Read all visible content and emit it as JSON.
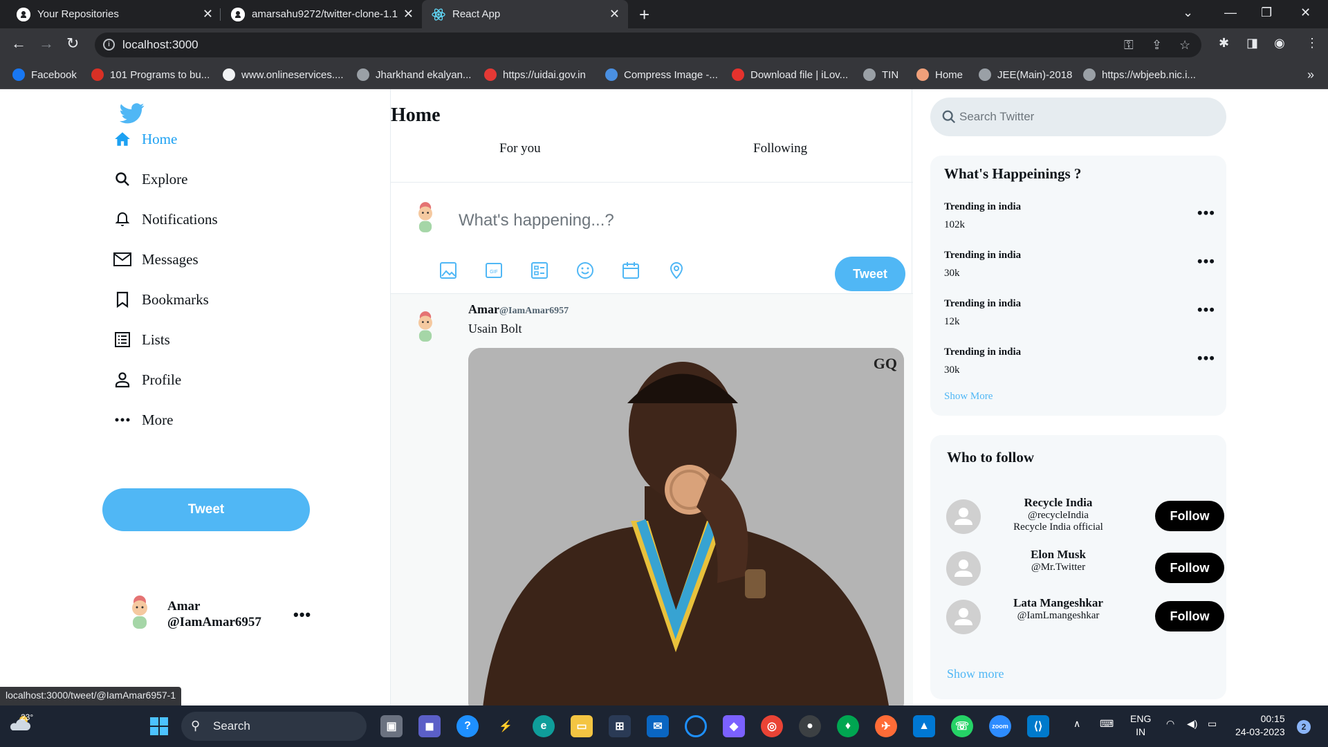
{
  "browser": {
    "tabs": [
      {
        "title": "Your Repositories"
      },
      {
        "title": "amarsahu9272/twitter-clone-1.1"
      },
      {
        "title": "React App"
      }
    ],
    "url": "localhost:3000",
    "bookmarks": [
      {
        "label": "Facebook",
        "color": "#1877f2"
      },
      {
        "label": "101 Programs to bu...",
        "color": "#d93025"
      },
      {
        "label": "www.onlineservices....",
        "color": "#f1f3f4"
      },
      {
        "label": "Jharkhand ekalyan...",
        "color": "#9aa0a6"
      },
      {
        "label": "https://uidai.gov.in",
        "color": "#e53935"
      },
      {
        "label": "Compress Image -...",
        "color": "#4a90e2"
      },
      {
        "label": "Download file | iLov...",
        "color": "#e5322d"
      },
      {
        "label": "TIN",
        "color": "#9aa0a6"
      },
      {
        "label": "Home",
        "color": "#f0a07a"
      },
      {
        "label": "JEE(Main)-2018",
        "color": "#9aa0a6"
      },
      {
        "label": "https://wbjeeb.nic.i...",
        "color": "#9aa0a6"
      }
    ],
    "status_url": "localhost:3000/tweet/@IamAmar6957-1"
  },
  "sidebar": {
    "nav": [
      {
        "label": "Home",
        "icon": "home-icon"
      },
      {
        "label": "Explore",
        "icon": "search-icon"
      },
      {
        "label": "Notifications",
        "icon": "bell-icon"
      },
      {
        "label": "Messages",
        "icon": "mail-icon"
      },
      {
        "label": "Bookmarks",
        "icon": "bookmark-icon"
      },
      {
        "label": "Lists",
        "icon": "list-icon"
      },
      {
        "label": "Profile",
        "icon": "person-icon"
      },
      {
        "label": "More",
        "icon": "more-icon"
      }
    ],
    "tweet_button": "Tweet",
    "user": {
      "name": "Amar",
      "handle": "@IamAmar6957"
    }
  },
  "feed": {
    "title": "Home",
    "tabs": [
      "For you",
      "Following"
    ],
    "compose_placeholder": "What's happening...?",
    "compose_icons": [
      "image-icon",
      "gif-icon",
      "poll-icon",
      "emoji-icon",
      "schedule-icon",
      "location-icon"
    ],
    "tweet_button": "Tweet",
    "post": {
      "name": "Amar",
      "handle": "@IamAmar6957",
      "text": "Usain Bolt",
      "image_watermark": "GQ"
    }
  },
  "right": {
    "search_placeholder": "Search Twitter",
    "happenings": {
      "title": "What's Happeinings ?",
      "items": [
        {
          "label": "Trending in india",
          "count": "102k"
        },
        {
          "label": "Trending in india",
          "count": "30k"
        },
        {
          "label": "Trending in india",
          "count": "12k"
        },
        {
          "label": "Trending in india",
          "count": "30k"
        }
      ],
      "show_more": "Show More"
    },
    "who_to_follow": {
      "title": "Who to follow",
      "people": [
        {
          "name": "Recycle India",
          "handle": "@recycleIndia",
          "bio": "Recycle India official"
        },
        {
          "name": "Elon Musk",
          "handle": "@Mr.Twitter",
          "bio": ""
        },
        {
          "name": "Lata Mangeshkar",
          "handle": "@IamLmangeshkar",
          "bio": ""
        }
      ],
      "follow_label": "Follow",
      "show_more": "Show more"
    },
    "accent_color": "#50b7f5"
  },
  "taskbar": {
    "weather": "23°",
    "search": "Search",
    "lang": [
      "ENG",
      "IN"
    ],
    "time": "00:15",
    "date": "24-03-2023",
    "notif_count": "2"
  }
}
